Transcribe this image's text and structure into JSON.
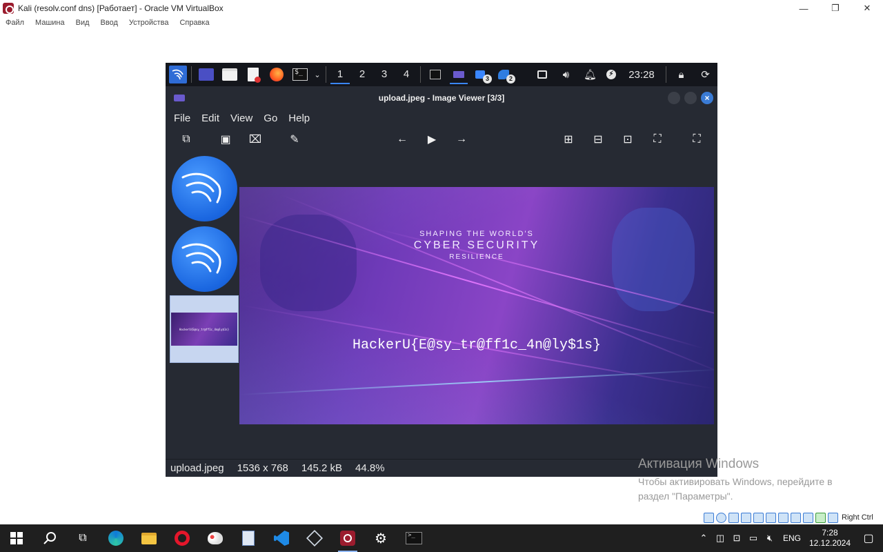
{
  "host_window": {
    "title": "Kali (resolv.conf dns) [Работает] - Oracle VM VirtualBox",
    "menu": [
      "Файл",
      "Машина",
      "Вид",
      "Ввод",
      "Устройства",
      "Справка"
    ],
    "minimize_glyph": "—",
    "restore_glyph": "❐",
    "close_glyph": "✕"
  },
  "kali_panel": {
    "workspaces": [
      "1",
      "2",
      "3",
      "4"
    ],
    "active_workspace": "1",
    "task_badges": [
      "3",
      "2"
    ],
    "clock": "23:28",
    "icons": [
      "kali-menu-icon",
      "desktop-icon",
      "file-manager-icon",
      "text-editor-icon",
      "firefox-icon",
      "terminal-icon",
      "chevron-down-icon",
      "terminal-task-icon",
      "image-viewer-task-icon",
      "kali-task-icon",
      "wireshark-task-icon",
      "network-icon",
      "volume-icon",
      "notifications-icon",
      "power-icon",
      "lock-icon",
      "logout-icon"
    ]
  },
  "image_viewer": {
    "title": "upload.jpeg - Image Viewer [3/3]",
    "menu": [
      "File",
      "Edit",
      "View",
      "Go",
      "Help"
    ],
    "image": {
      "line1": "SHAPING THE WORLD'S",
      "line2": "CYBER SECURITY",
      "line3": "RESILIENCE",
      "flag": "HackerU{E@sy_tr@ff1c_4n@ly$1s}"
    },
    "status": {
      "filename": "upload.jpeg",
      "dimensions": "1536 x 768",
      "size": "145.2 kB",
      "zoom": "44.8%"
    }
  },
  "activation": {
    "title": "Активация Windows",
    "line1": "Чтобы активировать Windows, перейдите в",
    "line2": "раздел \"Параметры\"."
  },
  "vb_status": {
    "host_key": "Right Ctrl"
  },
  "win_taskbar": {
    "lang": "ENG",
    "time": "7:28",
    "date": "12.12.2024"
  },
  "colors": {
    "panel_bg": "#14161c",
    "viewer_bg": "#262a33",
    "accent": "#3a86ff",
    "taskbar_bg": "#1f1f1f"
  }
}
